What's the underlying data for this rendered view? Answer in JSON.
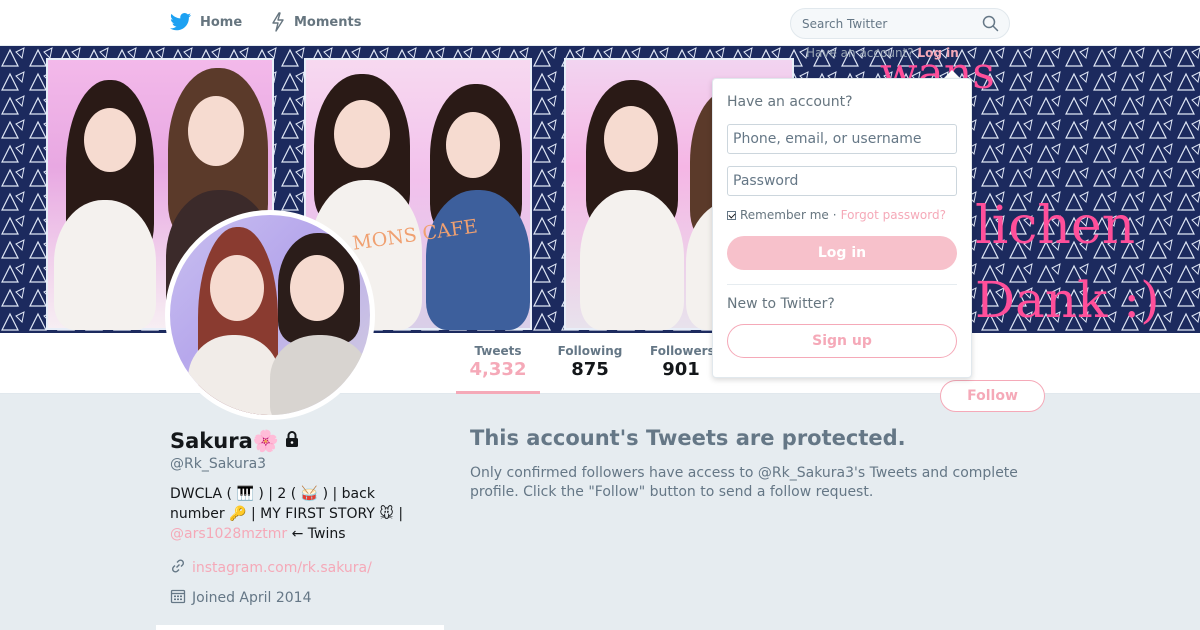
{
  "nav": {
    "home_label": "Home",
    "moments_label": "Moments",
    "search_placeholder": "Search Twitter"
  },
  "banner": {
    "account_prompt": "Have an account?",
    "login_link": "Log in",
    "decor_text_1": "wans",
    "decor_text_2": "lichen",
    "decor_text_3": "Dank :)",
    "photo_text": "MONS CAFE"
  },
  "stats": {
    "tweets_label": "Tweets",
    "tweets_value": "4,332",
    "following_label": "Following",
    "following_value": "875",
    "followers_label": "Followers",
    "followers_value": "901"
  },
  "follow_label": "Follow",
  "profile": {
    "name": "Sakura🌸",
    "handle": "@Rk_Sakura3",
    "bio_text": "DWCLA ( 🎹 ) | 2 ( 🥁 ) | back number 🔑 | MY FIRST STORY 🐭 | ",
    "bio_mention": "@ars1028mztmr",
    "bio_suffix": " ← Twins",
    "url": "instagram.com/rk.sakura/",
    "joined": "Joined April 2014"
  },
  "protected": {
    "title": "This account's Tweets are protected.",
    "body": "Only confirmed followers have access to @Rk_Sakura3's Tweets and complete profile. Click the \"Follow\" button to send a follow request."
  },
  "login_dropdown": {
    "heading": "Have an account?",
    "username_placeholder": "Phone, email, or username",
    "password_placeholder": "Password",
    "remember_label": "Remember me",
    "separator": "·",
    "forgot_label": "Forgot password?",
    "login_button": "Log in",
    "new_heading": "New to Twitter?",
    "signup_button": "Sign up"
  },
  "colors": {
    "accent": "#f5a9b8",
    "banner_bg": "#1c2a5e",
    "page_bg": "#e6ecf0"
  },
  "icons": [
    "twitter-bird-icon",
    "lightning-icon",
    "search-icon",
    "lock-icon",
    "link-icon",
    "calendar-icon"
  ]
}
